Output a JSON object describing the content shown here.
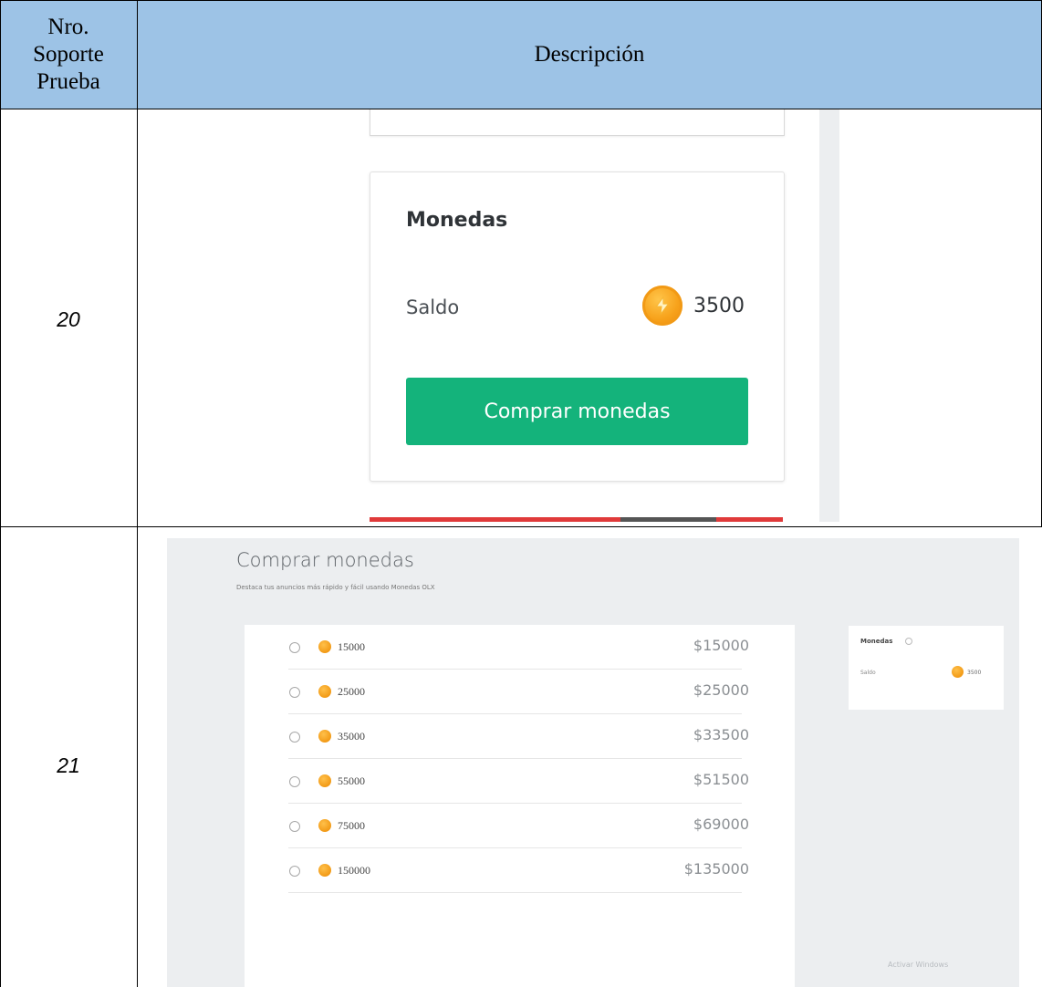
{
  "table": {
    "header": {
      "col_num_lines": [
        "Nro.",
        "Soporte",
        "Prueba"
      ],
      "col_desc": "Descripción"
    },
    "rows": [
      {
        "number": "20"
      },
      {
        "number": "21"
      }
    ]
  },
  "shot_balance": {
    "card_title": "Monedas",
    "saldo_label": "Saldo",
    "saldo_value": "3500",
    "coin_icon": "lightning-coin-icon",
    "buy_button_label": "Comprar monedas",
    "buy_button_color": "#14b37b"
  },
  "shot_purchase": {
    "title": "Comprar monedas",
    "subtitle": "Destaca tus anuncios más rápido y fácil usando Monedas OLX",
    "packs": [
      {
        "amount": "15000",
        "price": "$15000"
      },
      {
        "amount": "25000",
        "price": "$25000"
      },
      {
        "amount": "35000",
        "price": "$33500"
      },
      {
        "amount": "55000",
        "price": "$51500"
      },
      {
        "amount": "75000",
        "price": "$69000"
      },
      {
        "amount": "150000",
        "price": "$135000"
      }
    ],
    "side_card": {
      "title": "Monedas",
      "saldo_label": "Saldo",
      "saldo_value": "3500"
    },
    "watermark": "Activar Windows"
  },
  "colors": {
    "header_bg": "#9dc3e6",
    "coin": "#f29a16",
    "accent_red": "#e03a3a"
  }
}
